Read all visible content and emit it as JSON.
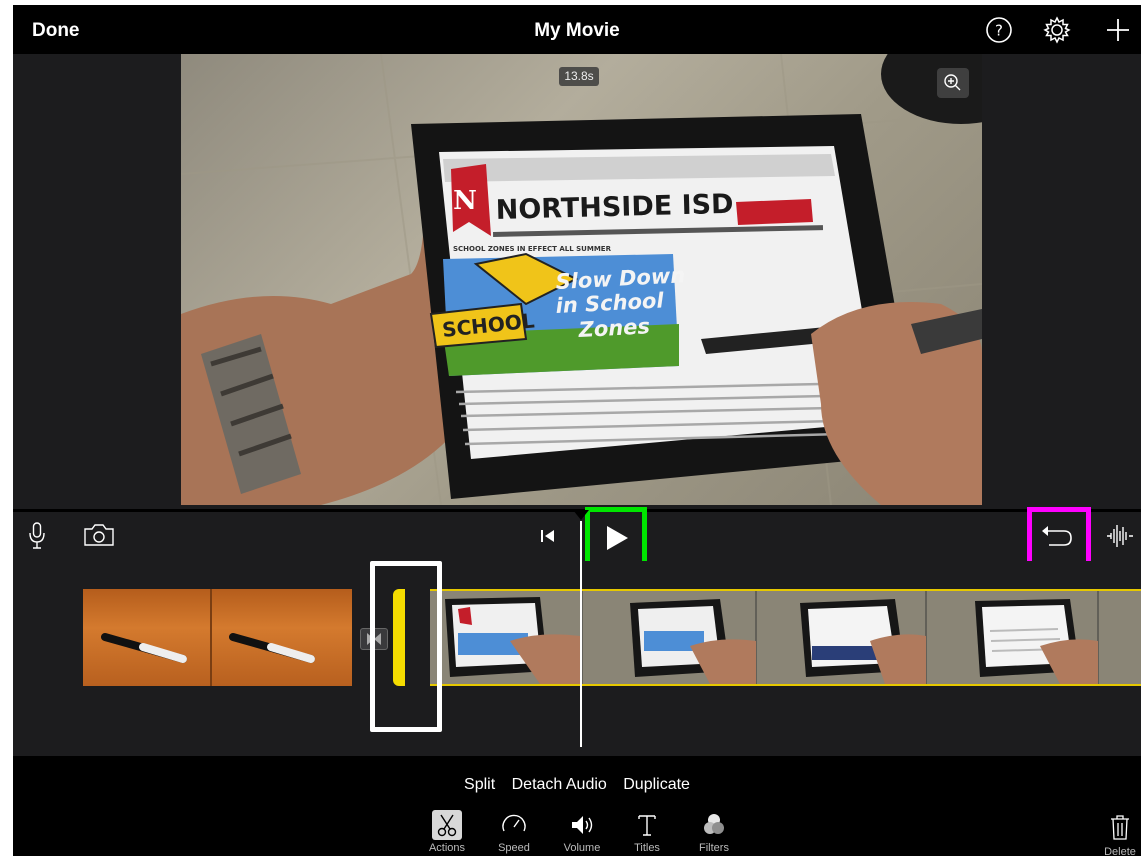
{
  "header": {
    "done_label": "Done",
    "title": "My Movie",
    "icons": [
      "help-icon",
      "settings-gear-icon",
      "add-plus-icon"
    ]
  },
  "viewer": {
    "duration_badge": "13.8s",
    "zoom_icon": "zoom-in-icon"
  },
  "toolbar": {
    "icons": [
      "microphone-icon",
      "camera-icon",
      "skip-to-start-icon",
      "play-icon",
      "undo-icon",
      "audio-waveform-icon"
    ]
  },
  "actions": [
    "Split",
    "Detach Audio",
    "Duplicate"
  ],
  "tabs": [
    {
      "label": "Actions",
      "icon": "scissors-icon",
      "active": true
    },
    {
      "label": "Speed",
      "icon": "speedometer-icon",
      "active": false
    },
    {
      "label": "Volume",
      "icon": "speaker-icon",
      "active": false
    },
    {
      "label": "Titles",
      "icon": "text-t-icon",
      "active": false
    },
    {
      "label": "Filters",
      "icon": "filter-circles-icon",
      "active": false
    }
  ],
  "delete_label": "Delete",
  "colors": {
    "play_highlight": "#00e600",
    "undo_highlight": "#ff00ff",
    "selection_yellow": "#f5dc00",
    "trim_highlight": "#ffffff"
  }
}
